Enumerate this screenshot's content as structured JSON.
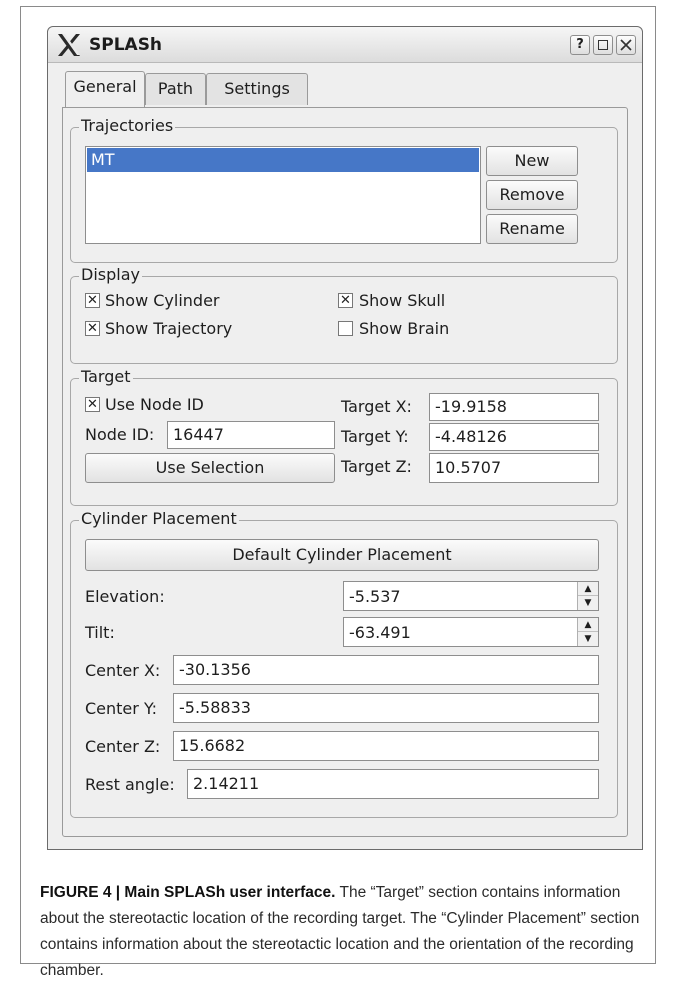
{
  "window": {
    "title": "SPLASh"
  },
  "titlebar_buttons": [
    "help-icon",
    "maximize-icon",
    "close-icon"
  ],
  "tabs": [
    {
      "label": "General",
      "active": true
    },
    {
      "label": "Path",
      "active": false
    },
    {
      "label": "Settings",
      "active": false
    }
  ],
  "trajectories": {
    "title": "Trajectories",
    "items": [
      "MT"
    ],
    "selected": "MT",
    "buttons": {
      "new": "New",
      "remove": "Remove",
      "rename": "Rename"
    }
  },
  "display": {
    "title": "Display",
    "show_cylinder": {
      "label": "Show Cylinder",
      "checked": true
    },
    "show_skull": {
      "label": "Show Skull",
      "checked": true
    },
    "show_trajectory": {
      "label": "Show Trajectory",
      "checked": true
    },
    "show_brain": {
      "label": "Show Brain",
      "checked": false
    }
  },
  "target": {
    "title": "Target",
    "use_node_id": {
      "label": "Use Node ID",
      "checked": true
    },
    "node_id_label": "Node ID:",
    "node_id": "16447",
    "use_selection": "Use Selection",
    "x_label": "Target X:",
    "x": "-19.9158",
    "y_label": "Target Y:",
    "y": "-4.48126",
    "z_label": "Target Z:",
    "z": "10.5707"
  },
  "cylinder": {
    "title": "Cylinder Placement",
    "default_button": "Default Cylinder Placement",
    "elevation_label": "Elevation:",
    "elevation": "-5.537",
    "tilt_label": "Tilt:",
    "tilt": "-63.491",
    "center_x_label": "Center X:",
    "center_x": "-30.1356",
    "center_y_label": "Center Y:",
    "center_y": "-5.58833",
    "center_z_label": "Center Z:",
    "center_z": "15.6682",
    "rest_angle_label": "Rest angle:",
    "rest_angle": "2.14211"
  },
  "caption": {
    "label": "FIGURE 4 | Main SPLASh user interface.",
    "text": " The “Target” section contains information about the stereotactic location of the recording target. The “Cylinder Placement” section contains information about the stereotactic location and the orientation of the recording chamber."
  },
  "colors": {
    "selection": "#4677c7",
    "window_bg": "#efefef"
  }
}
